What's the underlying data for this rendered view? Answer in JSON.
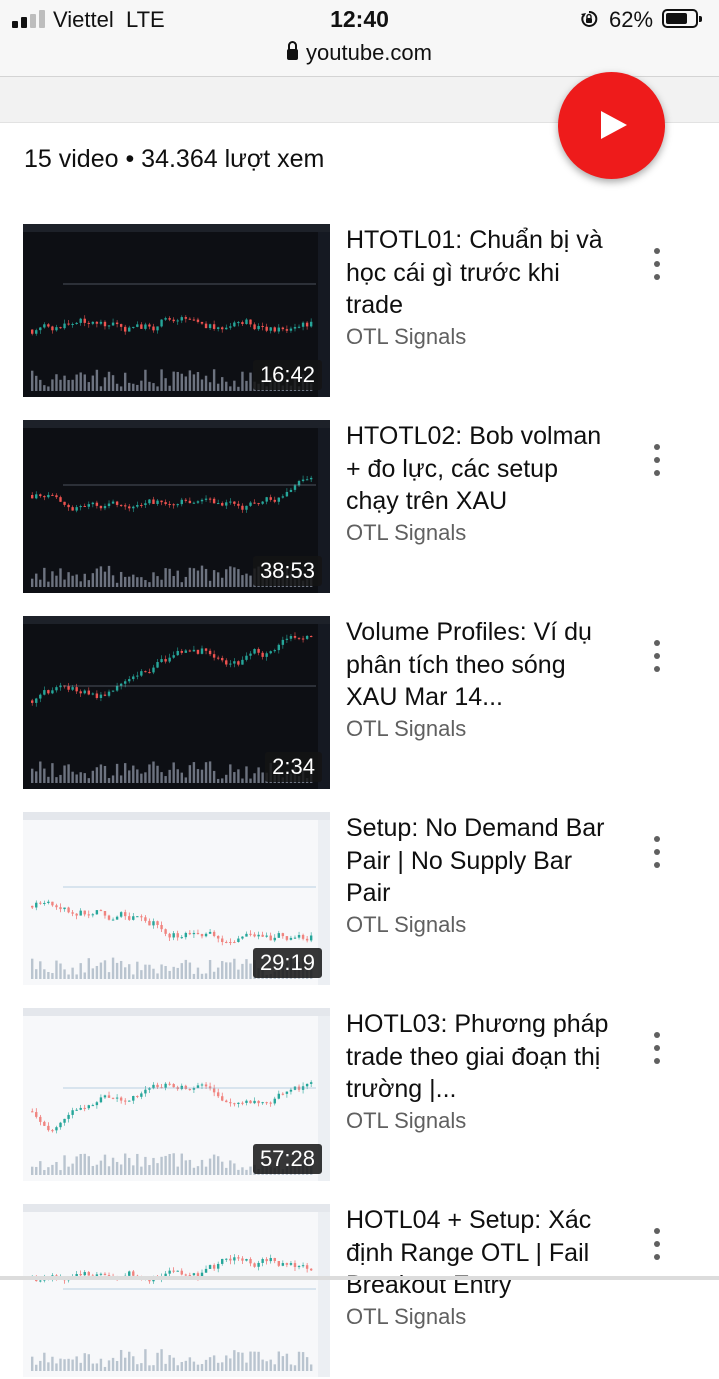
{
  "status_bar": {
    "carrier": "Viettel",
    "network": "LTE",
    "time": "12:40",
    "battery_percent": "62%",
    "battery_level": 0.62,
    "signal_bars": 2,
    "icons": [
      "signal-icon",
      "rotation-lock-icon",
      "battery-icon"
    ]
  },
  "browser": {
    "url": "youtube.com",
    "lock_icon": "lock-icon"
  },
  "playlist": {
    "stats": "15 video • 34.364 lượt xem",
    "play_button_icon": "play-icon",
    "accent_color": "#ee1b1b"
  },
  "videos": [
    {
      "title": "HTOTL01: Chuẩn bị và học cái gì trước khi trade",
      "channel": "OTL Signals",
      "duration": "16:42",
      "theme": "dark"
    },
    {
      "title": "HTOTL02: Bob volman + đo lực, các setup chạy trên XAU",
      "channel": "OTL Signals",
      "duration": "38:53",
      "theme": "dark"
    },
    {
      "title": "Volume Profiles: Ví dụ phân tích theo sóng XAU Mar 14...",
      "channel": "OTL Signals",
      "duration": "2:34",
      "theme": "dark"
    },
    {
      "title": "Setup: No Demand Bar Pair | No Supply Bar Pair",
      "channel": "OTL Signals",
      "duration": "29:19",
      "theme": "light"
    },
    {
      "title": "HOTL03: Phương pháp trade theo giai đoạn thị trường |...",
      "channel": "OTL Signals",
      "duration": "57:28",
      "theme": "light"
    },
    {
      "title": "HOTL04 + Setup: Xác định Range OTL | Fail Breakout Entry",
      "channel": "OTL Signals",
      "duration": "",
      "theme": "light"
    }
  ]
}
